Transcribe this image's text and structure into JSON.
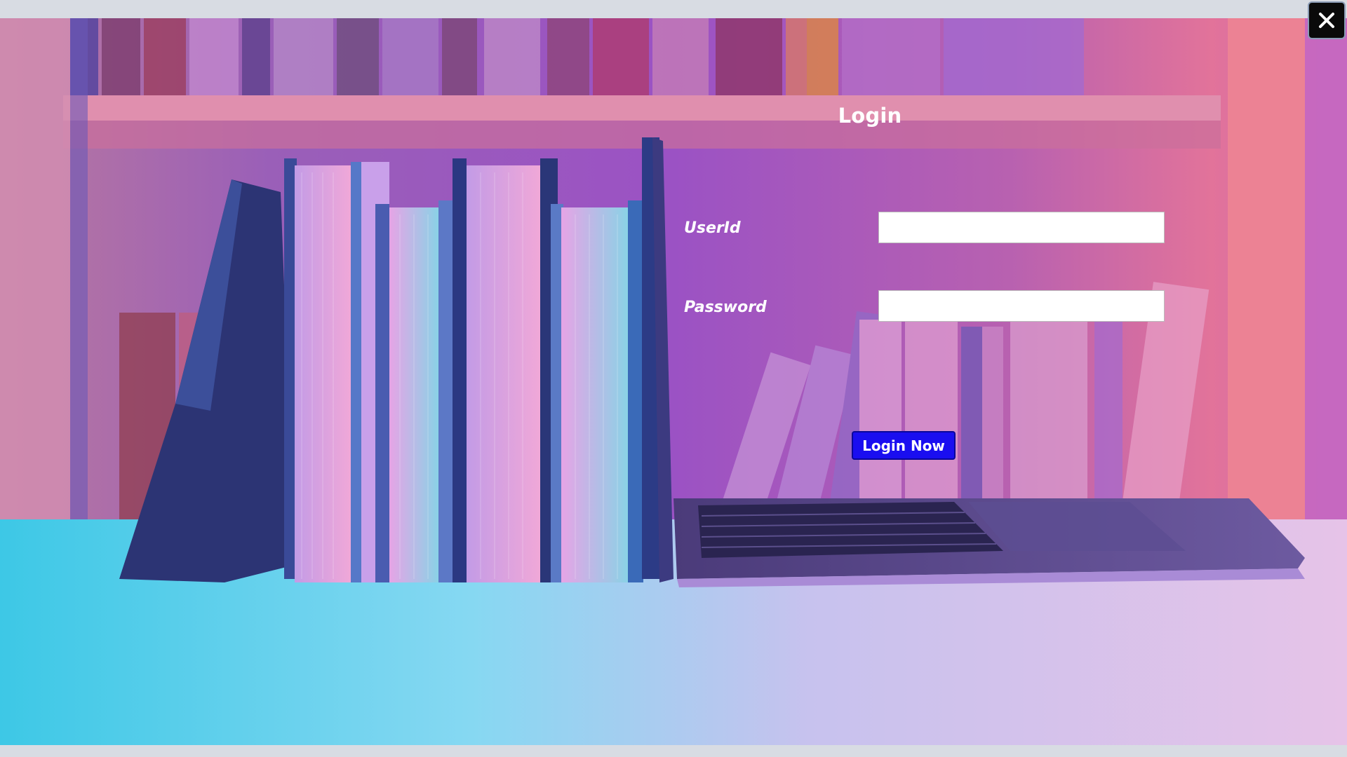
{
  "form": {
    "title": "Login",
    "userid_label": "UserId",
    "userid_value": "",
    "password_label": "Password",
    "password_value": "",
    "submit_label": "Login Now"
  },
  "window": {
    "close_icon": "close-icon"
  },
  "colors": {
    "button_bg": "#1a0ef0",
    "label_text": "#ffffff",
    "close_bg": "#0a0a0a"
  }
}
